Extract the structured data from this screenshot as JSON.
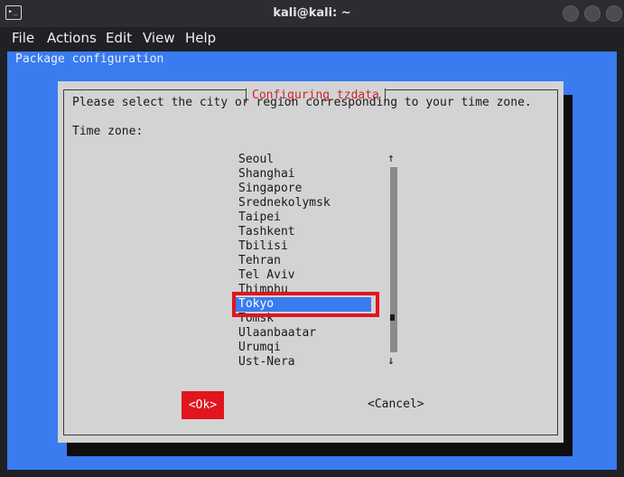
{
  "window": {
    "title": "kali@kali: ~",
    "icon": "terminal-icon",
    "icon_glyph": "▸_"
  },
  "menubar": {
    "items": [
      {
        "label": "File"
      },
      {
        "label": "Actions"
      },
      {
        "label": "Edit"
      },
      {
        "label": "View"
      },
      {
        "label": "Help"
      }
    ]
  },
  "terminal": {
    "header": "Package configuration",
    "dialog": {
      "title": "Configuring tzdata",
      "prompt": "Please select the city or region corresponding to your time zone.",
      "field_label": "Time zone:",
      "options": [
        "Seoul",
        "Shanghai",
        "Singapore",
        "Srednekolymsk",
        "Taipei",
        "Tashkent",
        "Tbilisi",
        "Tehran",
        "Tel Aviv",
        "Thimphu",
        "Tokyo",
        "Tomsk",
        "Ulaanbaatar",
        "Urumqi",
        "Ust-Nera"
      ],
      "selected": "Tokyo",
      "scroll_up": "↑",
      "scroll_down": "↓",
      "ok_label": "<Ok>",
      "cancel_label": "<Cancel>"
    }
  },
  "colors": {
    "accent_blue": "#3a7bf0",
    "title_red": "#d0242e",
    "highlight_red": "#e0151e",
    "dialog_bg": "#d3d3d3"
  }
}
